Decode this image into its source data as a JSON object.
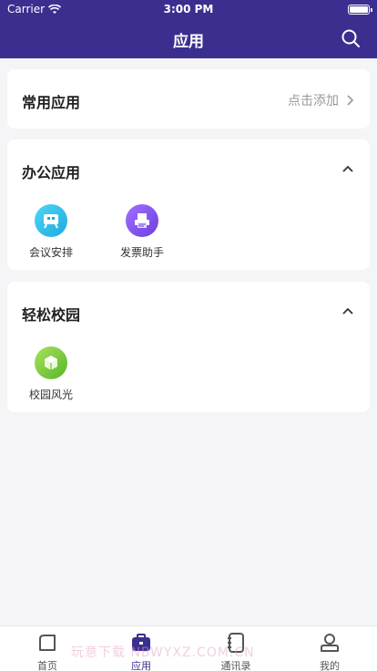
{
  "status": {
    "carrier": "Carrier",
    "time": "3:00 PM"
  },
  "nav": {
    "title": "应用",
    "search_icon": "search-icon"
  },
  "common": {
    "title": "常用应用",
    "action": "点击添加"
  },
  "office": {
    "title": "办公应用",
    "apps": [
      {
        "label": "会议安排",
        "icon": "meeting-icon",
        "color": "#35c2ea"
      },
      {
        "label": "发票助手",
        "icon": "invoice-icon",
        "color": "#8a5cf0"
      }
    ]
  },
  "campus": {
    "title": "轻松校园",
    "apps": [
      {
        "label": "校园风光",
        "icon": "campus-cube-icon",
        "color": "#7ccf3a"
      }
    ]
  },
  "tabs": [
    {
      "label": "首页",
      "icon": "home-icon"
    },
    {
      "label": "应用",
      "icon": "briefcase-icon",
      "active": true
    },
    {
      "label": "通讯录",
      "icon": "contacts-icon"
    },
    {
      "label": "我的",
      "icon": "profile-icon"
    }
  ],
  "watermark": "玩意下载 NBWYXZ.COM.CN"
}
